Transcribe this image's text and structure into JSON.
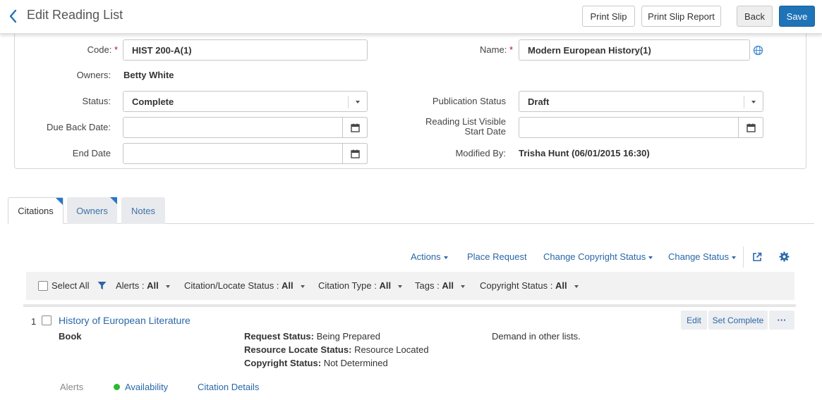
{
  "header": {
    "title": "Edit Reading List",
    "print_slip": "Print Slip",
    "print_slip_report": "Print Slip Report",
    "back": "Back",
    "save": "Save"
  },
  "form": {
    "code_label": "Code:",
    "code_value": "HIST 200-A(1)",
    "name_label": "Name:",
    "name_value": "Modern European History(1)",
    "required_mark": "*",
    "owners_label": "Owners:",
    "owners_value": "Betty White",
    "status_label": "Status:",
    "status_value": "Complete",
    "pub_status_label": "Publication Status",
    "pub_status_value": "Draft",
    "due_back_label": "Due Back Date:",
    "due_back_value": "",
    "visible_start_label_line1": "Reading List Visible",
    "visible_start_label_line2": "Start Date",
    "visible_start_value": "",
    "end_date_label": "End Date",
    "end_date_value": "",
    "modified_by_label": "Modified By:",
    "modified_by_value": "Trisha Hunt (06/01/2015 16:30)"
  },
  "tabs": [
    {
      "label": "Citations",
      "active": true
    },
    {
      "label": "Owners",
      "active": false
    },
    {
      "label": "Notes",
      "active": false
    }
  ],
  "toolbar": {
    "actions": "Actions",
    "place_request": "Place Request",
    "change_copyright": "Change Copyright Status",
    "change_status": "Change Status"
  },
  "filters": {
    "select_all": "Select All",
    "alerts_label": "Alerts :",
    "alerts_value": "All",
    "citation_locate_label": "Citation/Locate Status :",
    "citation_locate_value": "All",
    "citation_type_label": "Citation Type :",
    "citation_type_value": "All",
    "tags_label": "Tags :",
    "tags_value": "All",
    "copyright_label": "Copyright Status :",
    "copyright_value": "All"
  },
  "citation": {
    "index": "1",
    "title": "History of European Literature",
    "type": "Book",
    "request_status_label": "Request Status:",
    "request_status_value": "Being Prepared",
    "resource_locate_label": "Resource Locate Status:",
    "resource_locate_value": "Resource Located",
    "copyright_label": "Copyright Status:",
    "copyright_value": "Not Determined",
    "demand_text": "Demand in other lists.",
    "edit": "Edit",
    "set_complete": "Set Complete",
    "more": "···",
    "alerts": "Alerts",
    "availability": "Availability",
    "citation_details": "Citation Details"
  },
  "colors": {
    "primary": "#1f73b7",
    "link": "#2a67a8",
    "required": "#d0021b",
    "availability_dot": "#2eb82e"
  }
}
